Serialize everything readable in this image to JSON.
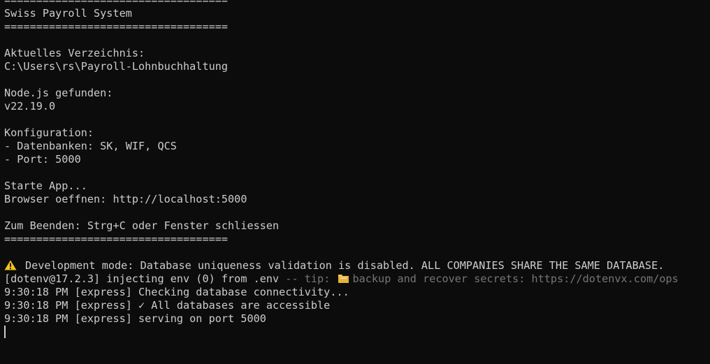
{
  "terminal": {
    "lines": {
      "sep0": "===================================",
      "title": "Swiss Payroll System",
      "sep1": "===================================",
      "cwd_label": "Aktuelles Verzeichnis:",
      "cwd_value": "C:\\Users\\rs\\Payroll-Lohnbuchhaltung",
      "node_label": "Node.js gefunden:",
      "node_value": "v22.19.0",
      "config_label": "Konfiguration:",
      "config_db": "- Datenbanken: SK, WIF, QCS",
      "config_port": "- Port: 5000",
      "start": "Starte App...",
      "browser": "Browser oeffnen: http://localhost:5000",
      "quit": "Zum Beenden: Strg+C oder Fenster schliessen",
      "sep2": "===================================",
      "warning": "Development mode: Database uniqueness validation is disabled. ALL COMPANIES SHARE THE SAME DATABASE.",
      "dotenv_main": "[dotenv@17.2.3] injecting env (0) from .env",
      "dotenv_tip_prefix": " -- tip: ",
      "dotenv_tip_text": "backup and recover secrets: https://dotenvx.com/ops",
      "log1": "9:30:18 PM [express] Checking database connectivity...",
      "log2": "9:30:18 PM [express] ✓ All databases are accessible",
      "log3": "9:30:18 PM [express] serving on port 5000"
    },
    "icons": {
      "warning": "warning-icon",
      "tip": "folder-icon"
    },
    "colors": {
      "background": "#0c0c0c",
      "foreground": "#cccccc",
      "dim": "#767676",
      "warning": "#f2c31a",
      "folder": "#f6c945"
    }
  }
}
